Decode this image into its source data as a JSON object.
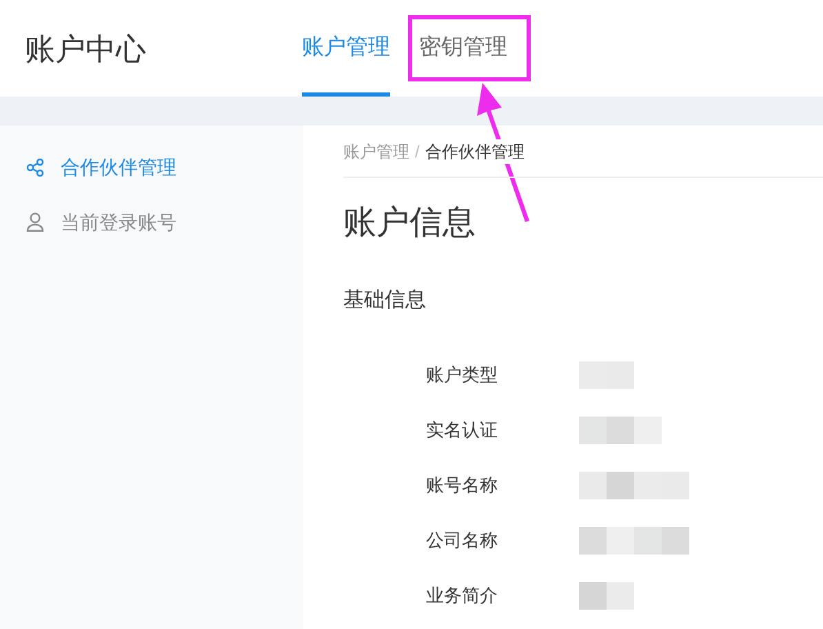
{
  "header": {
    "title": "账户中心"
  },
  "tabs": [
    {
      "label": "账户管理",
      "selected": true,
      "highlighted": false
    },
    {
      "label": "密钥管理",
      "selected": false,
      "highlighted": true
    }
  ],
  "sidebar": {
    "items": [
      {
        "label": "合作伙伴管理",
        "kind": "partners",
        "selected": true
      },
      {
        "label": "当前登录账号",
        "kind": "account",
        "selected": false
      }
    ]
  },
  "breadcrumb": {
    "separator": "/",
    "items": [
      {
        "label": "账户管理",
        "current": false
      },
      {
        "label": "合作伙伴管理",
        "current": true
      }
    ]
  },
  "page_title": "账户信息",
  "section_title": "基础信息",
  "fields": [
    {
      "label": "账户类型",
      "redacted": true
    },
    {
      "label": "实名认证",
      "redacted": true
    },
    {
      "label": "账号名称",
      "redacted": true
    },
    {
      "label": "公司名称",
      "redacted": true
    },
    {
      "label": "业务简介",
      "redacted": true
    }
  ]
}
